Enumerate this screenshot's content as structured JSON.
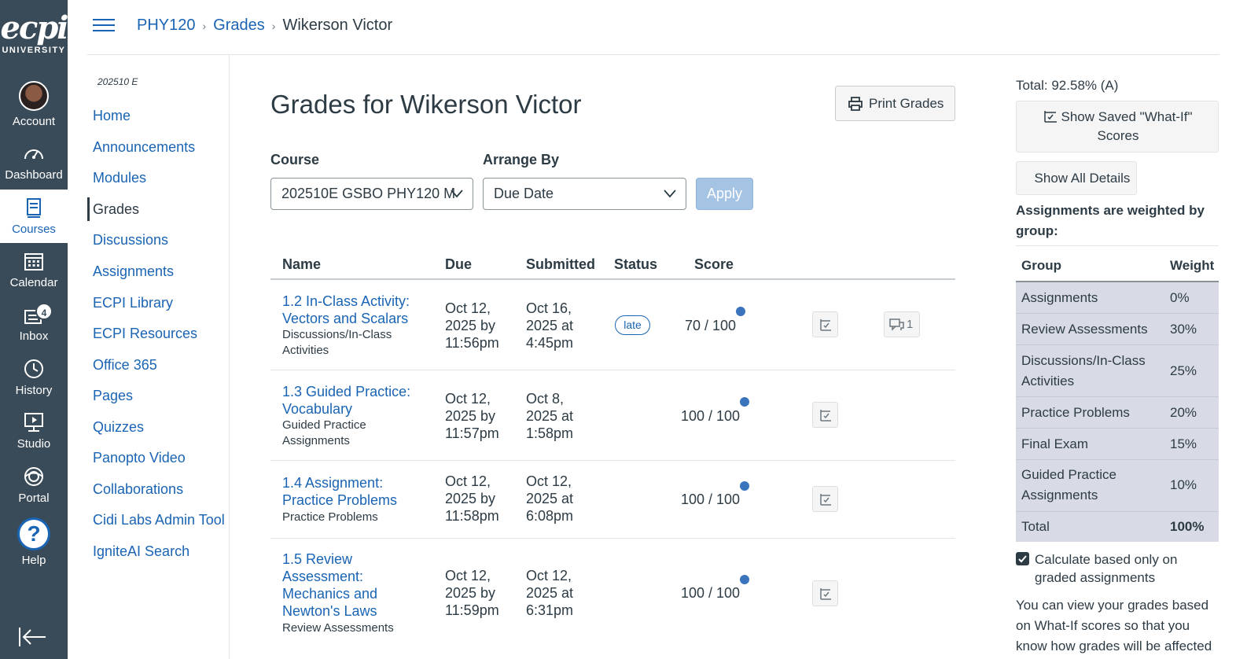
{
  "global_nav": {
    "logo_main": "ecpi",
    "logo_sub": "UNIVERSITY",
    "items": [
      {
        "label": "Account",
        "icon": "avatar"
      },
      {
        "label": "Dashboard",
        "icon": "dashboard-icon"
      },
      {
        "label": "Courses",
        "icon": "courses-icon"
      },
      {
        "label": "Calendar",
        "icon": "calendar-icon"
      },
      {
        "label": "Inbox",
        "icon": "inbox-icon",
        "badge": "4"
      },
      {
        "label": "History",
        "icon": "history-icon"
      },
      {
        "label": "Studio",
        "icon": "studio-icon"
      },
      {
        "label": "Portal",
        "icon": "portal-icon"
      },
      {
        "label": "Help",
        "icon": "help-icon",
        "glyph": "?"
      }
    ],
    "active_color": "#1a64b4",
    "bg_color": "#394b58"
  },
  "breadcrumb": {
    "items": [
      "PHY120",
      "Grades",
      "Wikerson Victor"
    ],
    "separator": "›"
  },
  "course_nav": {
    "term": "202510 E",
    "items": [
      "Home",
      "Announcements",
      "Modules",
      "Grades",
      "Discussions",
      "Assignments",
      "ECPI Library",
      "ECPI Resources",
      "Office 365",
      "Pages",
      "Quizzes",
      "Panopto Video",
      "Collaborations",
      "Cidi Labs Admin Tool",
      "IgniteAI Search"
    ],
    "active": "Grades"
  },
  "main": {
    "title": "Grades for Wikerson Victor",
    "print_label": "Print Grades",
    "course_label": "Course",
    "course_value": "202510E GSBO PHY120 M",
    "arrange_label": "Arrange By",
    "arrange_value": "Due Date",
    "apply_label": "Apply",
    "columns": [
      "Name",
      "Due",
      "Submitted",
      "Status",
      "Score"
    ],
    "rows": [
      {
        "name": "1.2 In-Class Activity: Vectors and Scalars",
        "group": "Discussions/In-Class Activities",
        "due": "Oct 12, 2025 by 11:56pm",
        "submitted": "Oct 16, 2025 at 4:45pm",
        "status": "late",
        "score": "70 / 100",
        "comments": "1"
      },
      {
        "name": "1.3 Guided Practice: Vocabulary",
        "group": "Guided Practice Assignments",
        "due": "Oct 12, 2025 by 11:57pm",
        "submitted": "Oct 8, 2025 at 1:58pm",
        "status": "",
        "score": "100 / 100",
        "comments": ""
      },
      {
        "name": "1.4 Assignment: Practice Problems",
        "group": "Practice Problems",
        "due": "Oct 12, 2025 by 11:58pm",
        "submitted": "Oct 12, 2025 at 6:08pm",
        "status": "",
        "score": "100 / 100",
        "comments": ""
      },
      {
        "name": "1.5 Review Assessment: Mechanics and Newton's Laws",
        "group": "Review Assessments",
        "due": "Oct 12, 2025 by 11:59pm",
        "submitted": "Oct 12, 2025 at 6:31pm",
        "status": "",
        "score": "100 / 100",
        "comments": ""
      }
    ]
  },
  "sidebar": {
    "total": "Total: 92.58% (A)",
    "saved_whatif_label": "Show Saved \"What-If\" Scores",
    "show_details_label": "Show All Details",
    "weighted_note": "Assignments are weighted by group:",
    "weight_header_group": "Group",
    "weight_header_weight": "Weight",
    "weights": [
      {
        "group": "Assignments",
        "weight": "0%"
      },
      {
        "group": "Review Assessments",
        "weight": "30%"
      },
      {
        "group": "Discussions/In-Class Activities",
        "weight": "25%"
      },
      {
        "group": "Practice Problems",
        "weight": "20%"
      },
      {
        "group": "Final Exam",
        "weight": "15%"
      },
      {
        "group": "Guided Practice Assignments",
        "weight": "10%"
      },
      {
        "group": "Total",
        "weight": "100%"
      }
    ],
    "calc_checkbox_label": "Calculate based only on graded assignments",
    "calc_checked": true,
    "whatif_paragraph": "You can view your grades based on What-If scores so that you know how grades will be affected"
  }
}
